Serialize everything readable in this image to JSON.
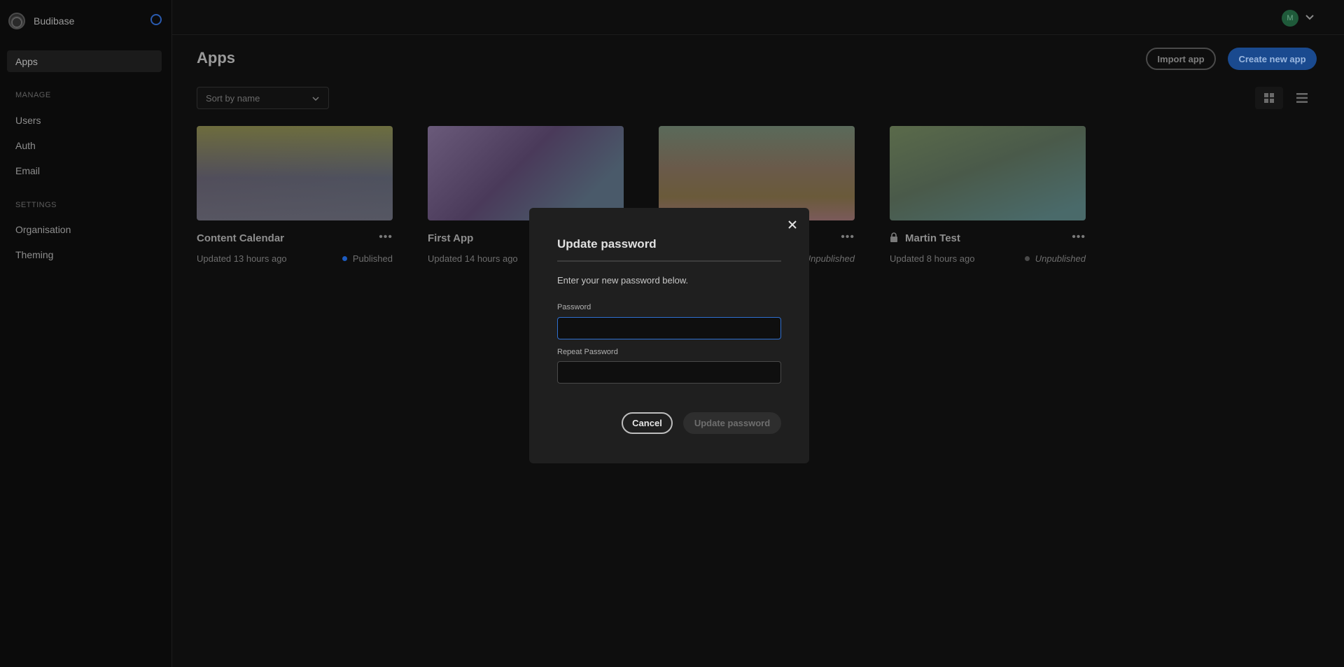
{
  "sidebar": {
    "brand": "Budibase",
    "apps_label": "Apps",
    "manage_section": "MANAGE",
    "manage_items": [
      "Users",
      "Auth",
      "Email"
    ],
    "settings_section": "SETTINGS",
    "settings_items": [
      "Organisation",
      "Theming"
    ]
  },
  "topbar": {
    "avatar_initial": "M"
  },
  "main": {
    "title": "Apps",
    "import_label": "Import app",
    "create_label": "Create new app",
    "sort_value": "Sort by name",
    "apps": [
      {
        "name": "Content Calendar",
        "updated": "Updated 13 hours ago",
        "status": "Published",
        "status_color": "#1d5bbf",
        "locked": false
      },
      {
        "name": "First App",
        "updated": "Updated 14 hours ago",
        "status": "",
        "status_color": "",
        "locked": false
      },
      {
        "name": "",
        "updated": "",
        "status": "Unpublished",
        "status_color": "",
        "locked": false
      },
      {
        "name": "Martin Test",
        "updated": "Updated 8 hours ago",
        "status": "Unpublished",
        "status_color": "#4a4a4a",
        "locked": true
      }
    ]
  },
  "modal": {
    "title": "Update password",
    "description": "Enter your new password below.",
    "password_label": "Password",
    "password_value": "",
    "repeat_label": "Repeat Password",
    "repeat_value": "",
    "cancel_label": "Cancel",
    "submit_label": "Update password"
  },
  "colors": {
    "accent": "#1a4a8f",
    "focus_border": "#2f6fd0"
  }
}
